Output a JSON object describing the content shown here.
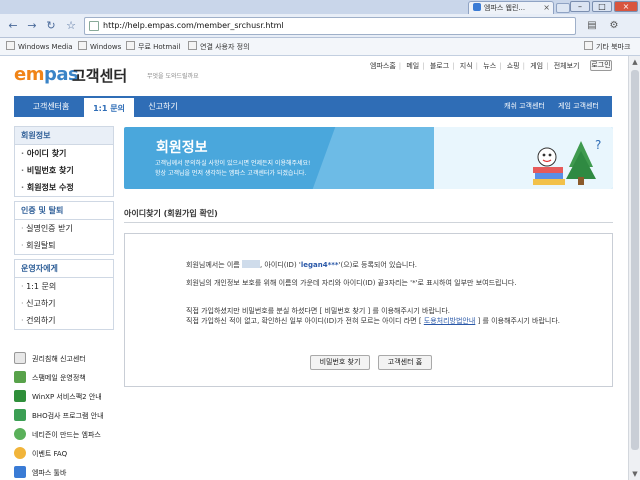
{
  "browser": {
    "tab_title": "엠파스 웹린...",
    "url": "http://help.empas.com/member_srchusr.html",
    "bookmarks": [
      "Windows Media",
      "Windows",
      "무료 Hotmail",
      "연결 사용자 정의"
    ],
    "other_bookmarks": "기타 북마크"
  },
  "header": {
    "logo_prefix": "em",
    "logo_suffix": "pas",
    "title": "고객센터",
    "subtitle": "무엇을 도와드릴까요",
    "top_menu": [
      "엠파스홈",
      "메일",
      "블로그",
      "지식",
      "뉴스",
      "쇼핑",
      "게임",
      "전체보기"
    ],
    "login": "로그인"
  },
  "tabs": {
    "items": [
      "고객센터홈",
      "1:1 문의",
      "신고하기"
    ],
    "active": "1:1 문의",
    "right": [
      "캐쉬 고객센터",
      "게임 고객센터"
    ]
  },
  "sidebar": {
    "groups": [
      {
        "title": "회원정보",
        "items": [
          "아이디 찾기",
          "비밀번호 찾기",
          "회원정보 수정"
        ]
      },
      {
        "title": "인증 및 탈퇴",
        "items": [
          "실명인증 받기",
          "회원탈퇴"
        ]
      },
      {
        "title": "운영자에게",
        "items": [
          "1:1 문의",
          "신고하기",
          "건의하기"
        ]
      }
    ],
    "links": [
      "권리침해 신고센터",
      "스팸메일 운영정책",
      "WinXP 서비스팩2 안내",
      "BHO검사 프로그램 안내",
      "네티즌이 만드는 엠파스",
      "이벤트 FAQ",
      "엠파스 툴바"
    ]
  },
  "banner": {
    "title": "회원정보",
    "desc1": "고객님께서 문의하실 사항이 있으시면 언제든지 이용해주세요!",
    "desc2": "항상 고객님을 먼저 생각하는 엠파스 고객센터가 되겠습니다."
  },
  "section": {
    "title": "아이디찾기 (회원가입 확인)"
  },
  "result": {
    "p1_a": "회원님께서는 이름",
    "p1_b": ", 아이디(ID) '",
    "user_id": "legan4***",
    "p1_c": "'(으)로 등록되어 있습니다.",
    "p2": "회원님의 개인정보 보호를 위해 이름의 가운데 자리와 아이디(ID) 끝3자리는 '*'로 표시하여 일부만 보여드립니다.",
    "p3": "직접 가입하셨지만 비밀번호를 분실 하셨다면 [ 비밀번호 찾기 ] 를 이용해주시기 바랍니다.",
    "p4_a": "직접 가입하신 적이 없고, 확인하신 일부 아이디(ID)가 전혀 모르는 아이디 라면 [",
    "p4_link": "도용처리방법안내",
    "p4_b": "] 를 이용해주시기 바랍니다.",
    "btn_password": "비밀번호 찾기",
    "btn_home": "고객센터 홈"
  }
}
